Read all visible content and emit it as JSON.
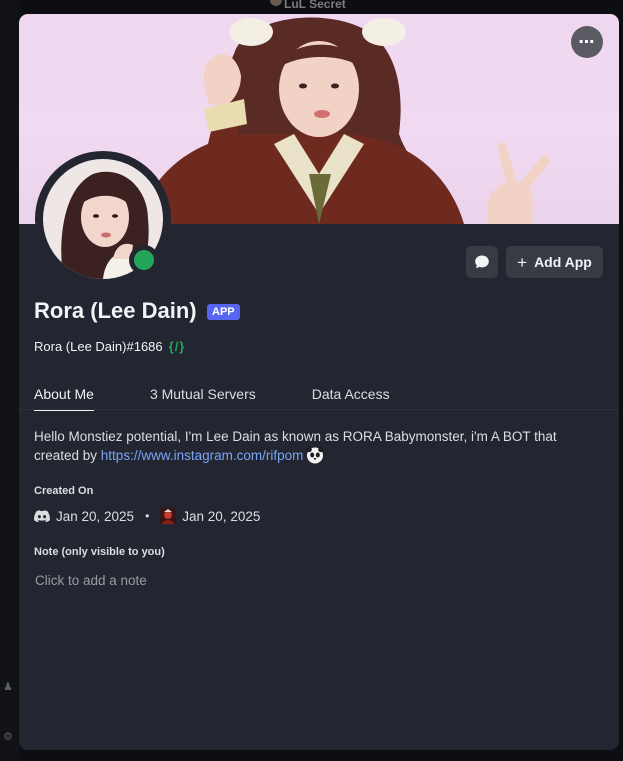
{
  "background": {
    "top_label": "LuL Secret"
  },
  "banner": {
    "more_label": "⋯"
  },
  "profile": {
    "display_name": "Rora (Lee Dain)",
    "app_tag": "APP",
    "username": "Rora (Lee Dain)#1686",
    "slash_badge": "{/}",
    "status": "online",
    "status_color": "#23a55a"
  },
  "actions": {
    "add_app_label": "Add App",
    "add_app_icon": "plus-icon",
    "message_icon": "chat-bubble-icon"
  },
  "tabs": [
    {
      "label": "About Me",
      "active": true
    },
    {
      "label": "3 Mutual Servers",
      "active": false
    },
    {
      "label": "Data Access",
      "active": false
    }
  ],
  "about": {
    "text": "Hello Monstiez potential, I'm Lee Dain as known as RORA Babymonster, i'm A BOT that created by ",
    "link": "https://www.instagram.com/rifpom",
    "emoji": "panda-icon"
  },
  "created_on": {
    "title": "Created On",
    "discord_date": "Jan 20, 2025",
    "server_date": "Jan 20, 2025",
    "separator": "•"
  },
  "note": {
    "title": "Note (only visible to you)",
    "placeholder": "Click to add a note",
    "value": ""
  },
  "colors": {
    "card_bg": "#232530",
    "accent": "#5865f2",
    "link": "#79a6f5",
    "online": "#23a55a"
  }
}
